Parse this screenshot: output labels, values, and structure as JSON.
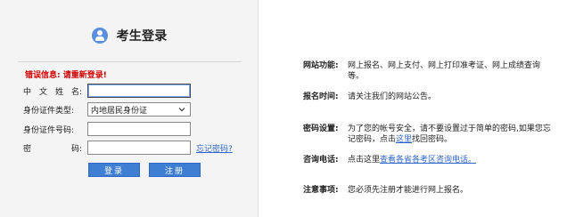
{
  "login": {
    "title": "考生登录",
    "error": "错误信息: 请重新登录!",
    "fields": {
      "name": {
        "label_chars": [
          "中",
          "文",
          "姓",
          "名:"
        ],
        "value": ""
      },
      "id_type": {
        "label": "身份证件类型:",
        "selected": "内地居民身份证"
      },
      "id_number": {
        "label": "身份证件号码:",
        "value": ""
      },
      "password": {
        "label_chars": [
          "密",
          "码:"
        ],
        "value": ""
      }
    },
    "forgot_password": "忘记密码?",
    "buttons": {
      "login": "登录",
      "register": "注册"
    }
  },
  "info": {
    "rows": [
      {
        "label": "网站功能:",
        "text": "网上报名、网上支付、网上打印准考证、网上成绩查询等。"
      },
      {
        "label": "报名时间:",
        "text": "请关注我们的网站公告。"
      },
      {
        "label": "密码设置:",
        "text_before": "为了您的帐号安全，请不要设置过于简单的密码,如果您忘记密码，点击",
        "link": "这里",
        "text_after": "找回密码。"
      },
      {
        "label": "咨询电话:",
        "text_before": "点击这里",
        "link": "查看各省各考区咨询电话。",
        "text_after": ""
      },
      {
        "label": "注意事项:",
        "text": "您必须先注册才能进行网上报名。"
      }
    ]
  },
  "colors": {
    "accent": "#3f7fd3",
    "link": "#2f66c8",
    "error": "#d10000",
    "panel_bg": "#f4f4f4"
  },
  "icons": {
    "avatar": "user-avatar-icon",
    "chevron": "chevron-down-icon"
  }
}
